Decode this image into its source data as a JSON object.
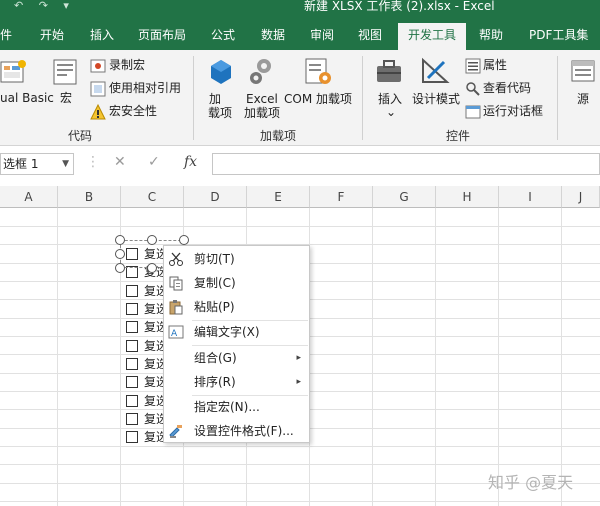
{
  "window": {
    "title": "新建 XLSX 工作表 (2).xlsx  -  Excel",
    "qat": "↶ ↷ ▾"
  },
  "tabs": [
    {
      "label": "件"
    },
    {
      "label": "开始"
    },
    {
      "label": "插入"
    },
    {
      "label": "页面布局"
    },
    {
      "label": "公式"
    },
    {
      "label": "数据"
    },
    {
      "label": "审阅"
    },
    {
      "label": "视图"
    },
    {
      "label": "开发工具"
    },
    {
      "label": "帮助"
    },
    {
      "label": "PDF工具集"
    }
  ],
  "ribbon": {
    "code": {
      "visual_basic": "ual Basic",
      "macros": "宏",
      "record_macro": "录制宏",
      "relative_refs": "使用相对引用",
      "macro_security": "宏安全性",
      "group": "代码"
    },
    "addins": {
      "addins": [
        "加",
        "载项"
      ],
      "excel_addins": [
        "Excel",
        "加载项"
      ],
      "com_addins": "COM 加载项",
      "group": "加载项"
    },
    "controls": {
      "insert": "插入",
      "insert_arrow": "⌄",
      "design_mode": "设计模式",
      "properties": "属性",
      "view_code": "查看代码",
      "run_dialog": "运行对话框",
      "group": "控件"
    },
    "source": "源"
  },
  "formula_bar": {
    "name_box": "选框 1",
    "cancel": "✕",
    "enter": "✓",
    "fx": "fx",
    "content": ""
  },
  "columns": [
    "A",
    "B",
    "C",
    "D",
    "E",
    "F",
    "G",
    "H",
    "I",
    "J"
  ],
  "checkbox_label": "复选",
  "checkboxes": [
    "复选",
    "复选",
    "复选",
    "复选",
    "复选",
    "复选",
    "复选",
    "复选",
    "复选",
    "复选",
    "复选"
  ],
  "context_menu": [
    {
      "label": "剪切(T)",
      "icon": "scissors-icon"
    },
    {
      "label": "复制(C)",
      "icon": "copy-icon"
    },
    {
      "label": "粘贴(P)",
      "icon": "paste-icon"
    },
    {
      "label": "编辑文字(X)",
      "icon": "edit-text-icon"
    },
    {
      "label": "组合(G)",
      "icon": "",
      "submenu": "▸"
    },
    {
      "label": "排序(R)",
      "icon": "",
      "submenu": "▸"
    },
    {
      "label": "指定宏(N)...",
      "icon": ""
    },
    {
      "label": "设置控件格式(F)...",
      "icon": "format-control-icon"
    }
  ],
  "watermark": "知乎 @夏天",
  "colors": {
    "excel_green": "#217346",
    "ribbon_bg": "#f3f3f3"
  }
}
